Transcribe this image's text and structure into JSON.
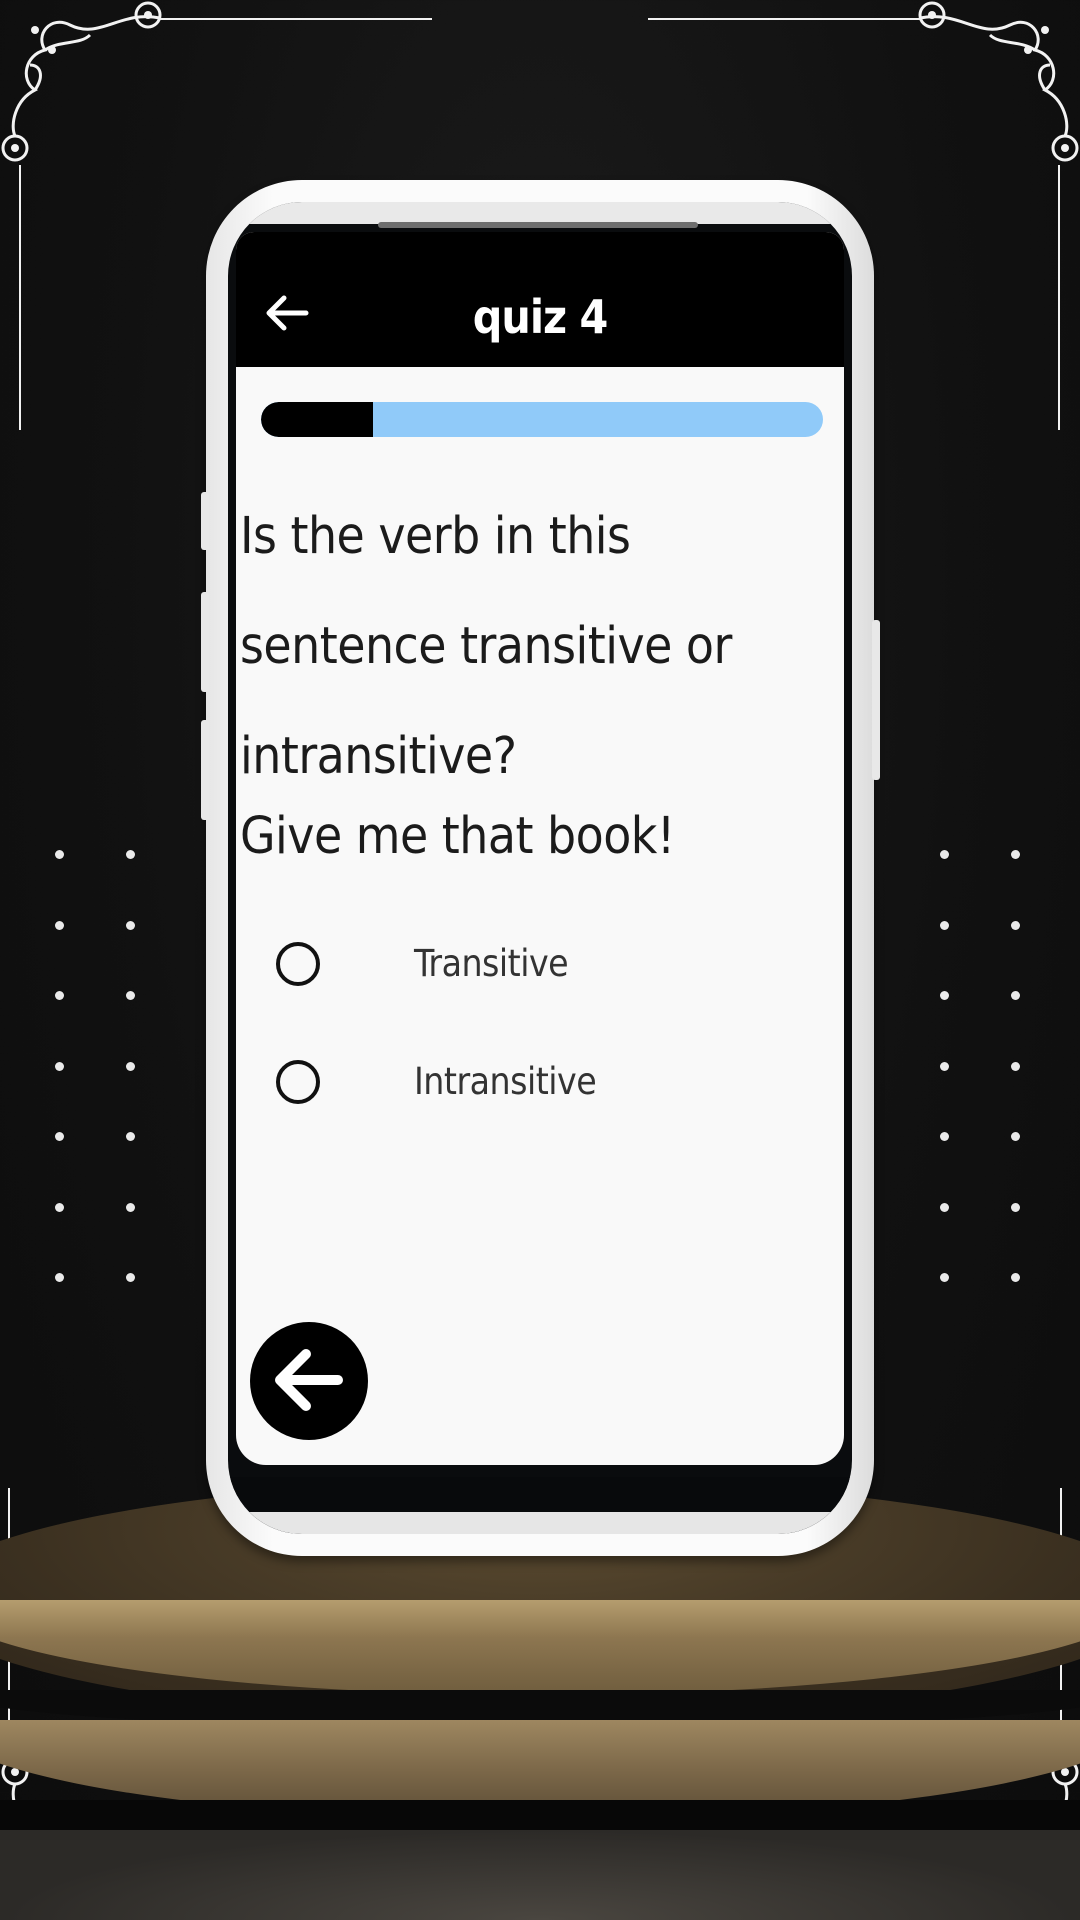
{
  "app": {
    "title": "quiz 4",
    "back_icon": "arrow-left-icon"
  },
  "progress": {
    "fraction": 0.2,
    "fill_color": "#000000",
    "track_color": "#90caf9"
  },
  "question": {
    "text": "Is the verb in this sentence transitive or intransitive?",
    "sentence": "Give me that book!"
  },
  "options": [
    {
      "label": "Transitive",
      "selected": false
    },
    {
      "label": "Intransitive",
      "selected": false
    }
  ],
  "fab": {
    "icon": "arrow-left-icon"
  },
  "colors": {
    "appbar": "#000000",
    "screen_bg": "#f9f9f9",
    "text": "#1b1b1b"
  }
}
